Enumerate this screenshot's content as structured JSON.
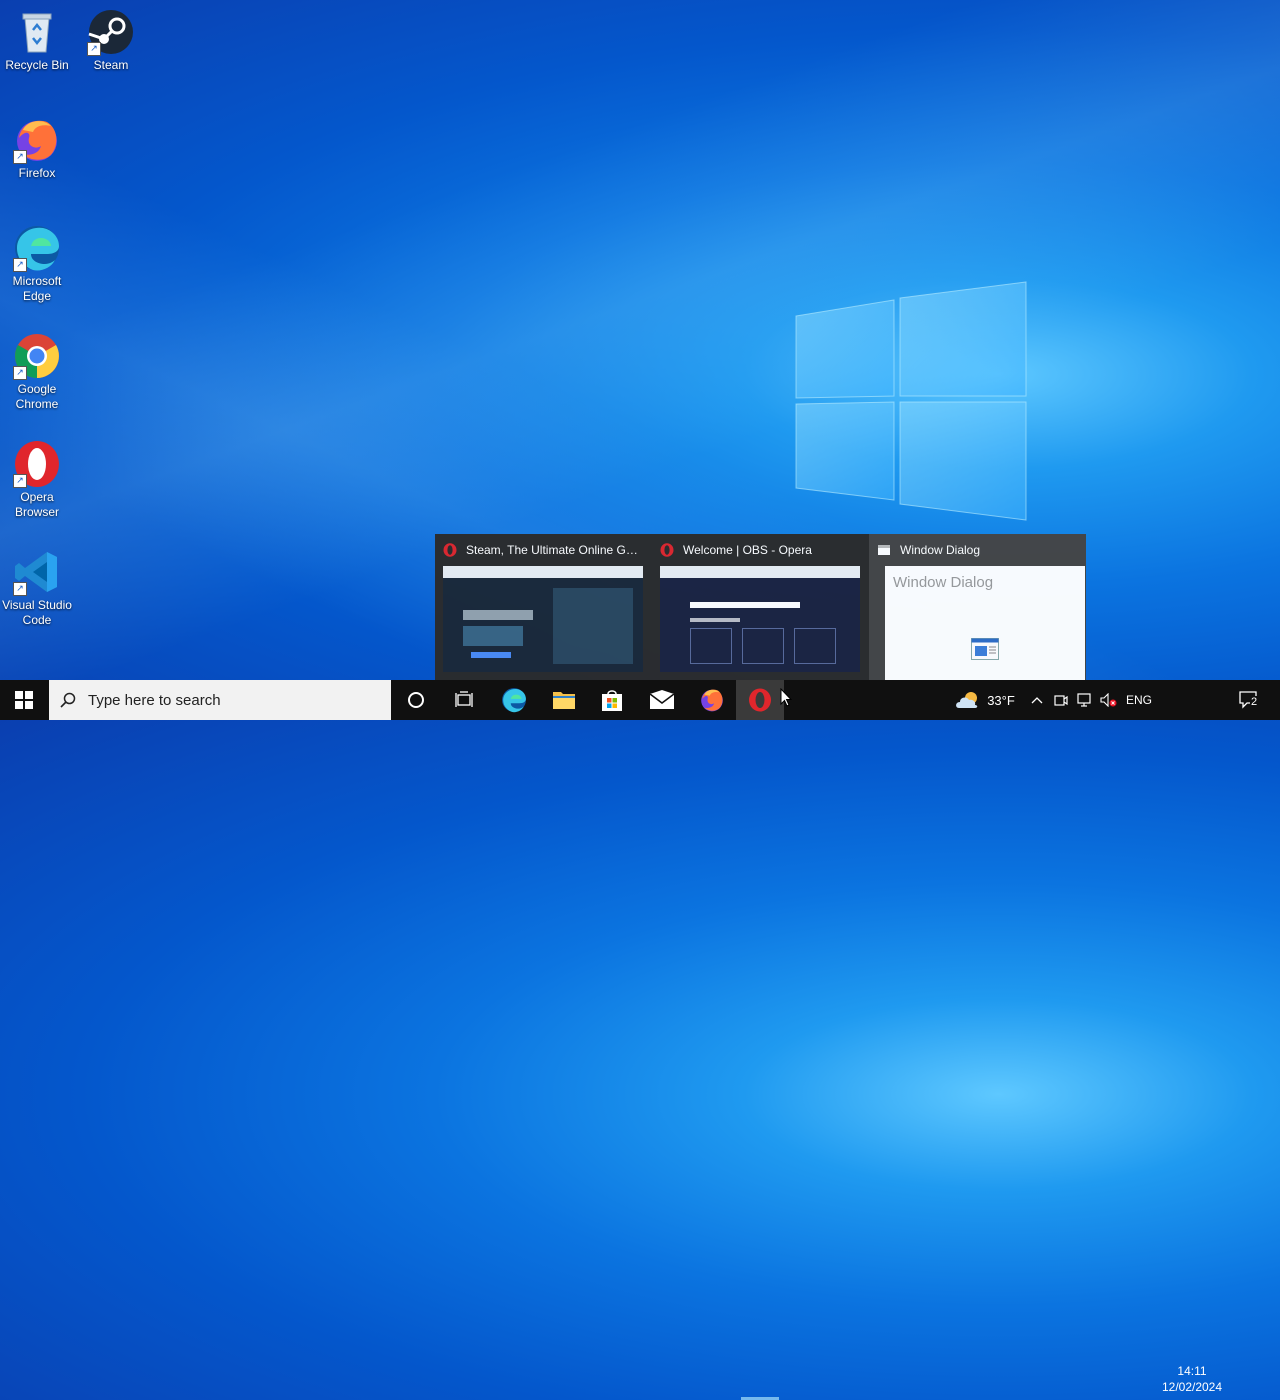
{
  "desktop": {
    "icons": [
      {
        "label": "Recycle Bin",
        "icon": "recycle-bin-icon"
      },
      {
        "label": "Steam",
        "icon": "steam-icon"
      },
      {
        "label": "Firefox",
        "icon": "firefox-icon"
      },
      {
        "label": "Microsoft Edge",
        "icon": "edge-icon"
      },
      {
        "label": "Google Chrome",
        "icon": "chrome-icon"
      },
      {
        "label": "Opera Browser",
        "icon": "opera-icon"
      },
      {
        "label": "Visual Studio Code",
        "icon": "vscode-icon"
      }
    ]
  },
  "thumbnails": {
    "items": [
      {
        "title": "Steam, The Ultimate Online Ga...",
        "icon": "opera-icon"
      },
      {
        "title": "Welcome | OBS - Opera",
        "icon": "opera-icon"
      },
      {
        "title": "Window Dialog",
        "icon": "window-icon",
        "preview_text": "Window Dialog"
      }
    ]
  },
  "taskbar": {
    "search_placeholder": "Type here to search",
    "apps": [
      "start-icon",
      "search-icon",
      "copilot-icon",
      "cortana-icon",
      "task-view-icon",
      "edge-icon",
      "file-explorer-icon",
      "store-icon",
      "mail-icon",
      "firefox-icon",
      "opera-icon"
    ],
    "tray": {
      "weather": "33°F",
      "language": "ENG",
      "time": "14:11",
      "date": "12/02/2024",
      "notifications": "2"
    }
  },
  "colors": {
    "accent": "#76b9ed",
    "taskbar": "#101010",
    "opera_red": "#e0262c"
  }
}
